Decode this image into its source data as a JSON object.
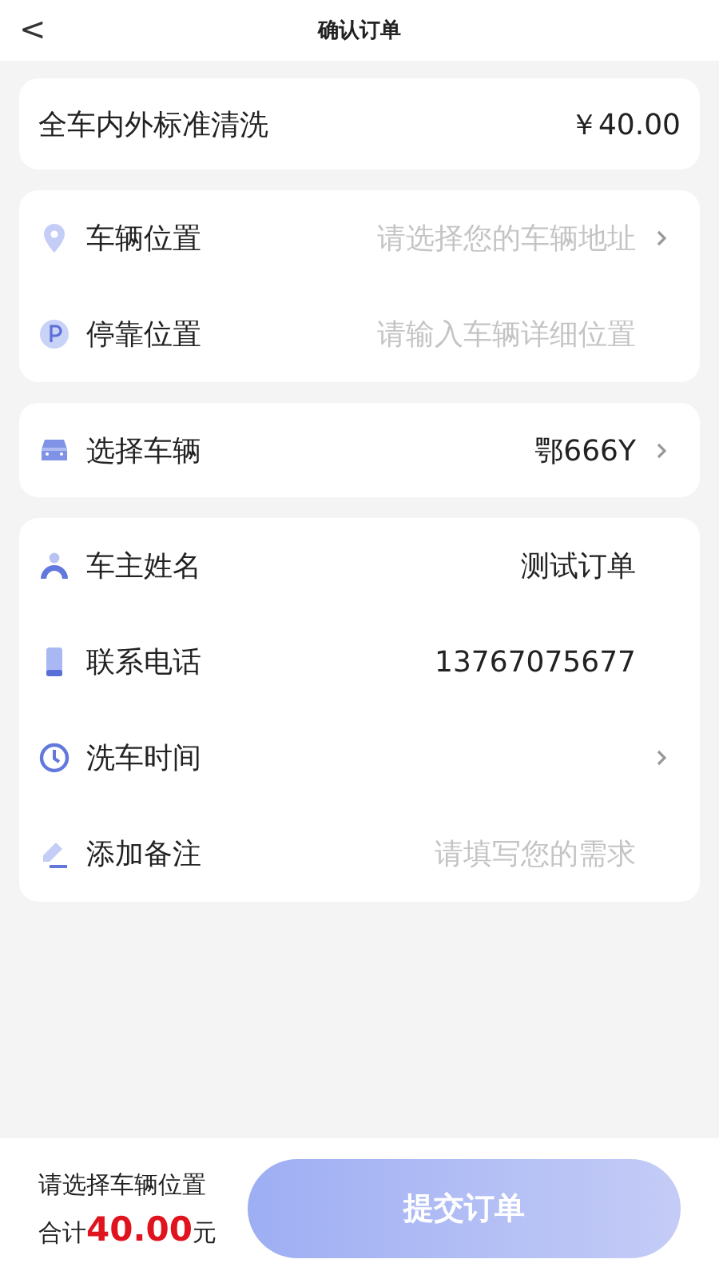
{
  "header": {
    "back": "<",
    "title": "确认订单"
  },
  "service": {
    "name": "全车内外标准清洗",
    "price": "￥40.00"
  },
  "groups": [
    {
      "rows": [
        {
          "label": "车辆位置",
          "placeholder": "请选择您的车辆地址",
          "chevron": true
        },
        {
          "label": "停靠位置",
          "placeholder": "请输入车辆详细位置",
          "chevron": false
        }
      ]
    },
    {
      "rows": [
        {
          "label": "选择车辆",
          "value": "鄂666Y",
          "chevron": true
        }
      ]
    },
    {
      "rows": [
        {
          "label": "车主姓名",
          "value": "测试订单",
          "chevron": false
        },
        {
          "label": "联系电话",
          "value": "13767075677",
          "chevron": false
        },
        {
          "label": "洗车时间",
          "chevron": true
        },
        {
          "label": "添加备注",
          "placeholder": "请填写您的需求",
          "chevron": false
        }
      ]
    }
  ],
  "footer": {
    "hint": "请选择车辆位置",
    "total": "合计**40.00**元",
    "submit": {
      "label": "提交订单",
      "disabled": true
    }
  }
}
